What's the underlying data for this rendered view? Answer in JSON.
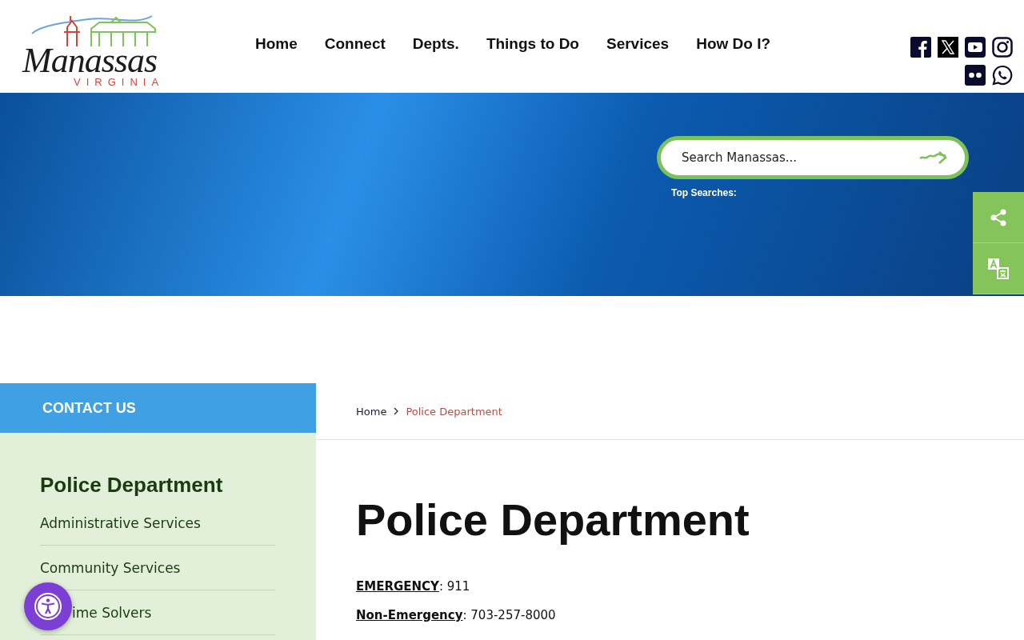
{
  "logo": {
    "name": "Manassas",
    "subtitle": "VIRGINIA"
  },
  "nav": [
    "Home",
    "Connect",
    "Depts.",
    "Things to Do",
    "Services",
    "How Do I?"
  ],
  "search": {
    "placeholder": "Search Manassas...",
    "top_searches_label": "Top Searches:"
  },
  "sidebar": {
    "contact": "CONTACT US",
    "title": "Police Department",
    "items": [
      {
        "label": "Administrative Services"
      },
      {
        "label": "Community Services"
      },
      {
        "label": "ime Solvers",
        "kind": "covered"
      }
    ]
  },
  "breadcrumb": [
    {
      "label": "Home",
      "current": false
    },
    {
      "label": "Police Department",
      "current": true
    }
  ],
  "page_title": "Police Department",
  "contacts": [
    "**EMERGENCY**: 911",
    "**Non-Emergency**: 703-257-8000"
  ]
}
